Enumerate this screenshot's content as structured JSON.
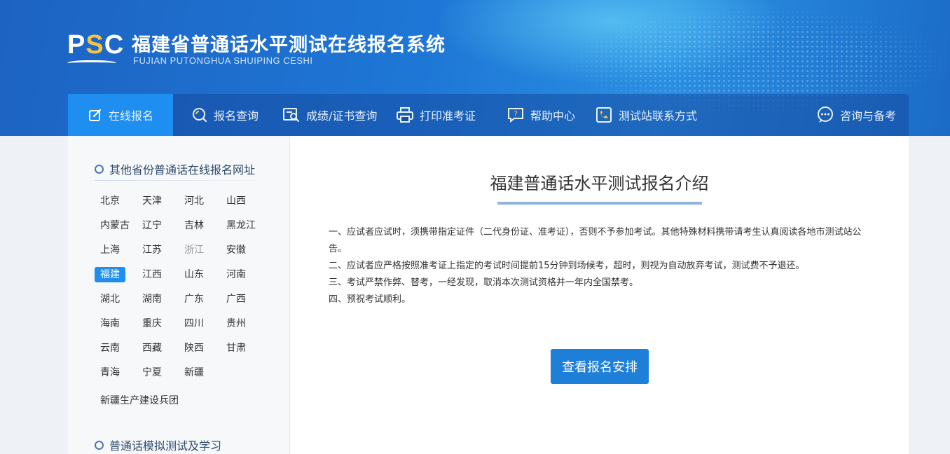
{
  "header": {
    "logo_text_p": "P",
    "logo_text_s": "S",
    "logo_text_c": "C",
    "title": "福建省普通话水平测试在线报名系统",
    "subtitle": "FUJIAN PUTONGHUA SHUIPING CESHI"
  },
  "nav": {
    "items": [
      {
        "label": "在线报名",
        "icon": "edit-icon"
      },
      {
        "label": "报名查询",
        "icon": "search-icon"
      },
      {
        "label": "成绩/证书查询",
        "icon": "certificate-search-icon"
      },
      {
        "label": "打印准考证",
        "icon": "printer-icon"
      },
      {
        "label": "帮助中心",
        "icon": "help-icon"
      },
      {
        "label": "测试站联系方式",
        "icon": "phone-icon"
      },
      {
        "label": "咨询与备考",
        "icon": "chat-icon"
      }
    ]
  },
  "sidebar": {
    "section1_title": "其他省份普通话在线报名网址",
    "provinces": [
      "北京",
      "天津",
      "河北",
      "山西",
      "内蒙古",
      "辽宁",
      "吉林",
      "黑龙江",
      "上海",
      "江苏",
      "浙江",
      "安徽",
      "福建",
      "江西",
      "山东",
      "河南",
      "湖北",
      "湖南",
      "广东",
      "广西",
      "海南",
      "重庆",
      "四川",
      "贵州",
      "云南",
      "西藏",
      "陕西",
      "甘肃",
      "青海",
      "宁夏",
      "新疆"
    ],
    "extra_province": "新疆生产建设兵团",
    "active_province": "福建",
    "disabled_province": "浙江",
    "section2_title": "普通话模拟测试及学习"
  },
  "main": {
    "title": "福建普通话水平测试报名介绍",
    "rules": [
      "一、应试者应试时，须携带指定证件（二代身份证、准考证），否则不予参加考试。其他特殊材料携带请考生认真阅读各地市测试站公告。",
      "二、应试者应严格按照准考证上指定的考试时间提前15分钟到场候考，超时，则视为自动放弃考试，测试费不予退还。",
      "三、考试严禁作弊、替考，一经发现，取消本次测试资格并一年内全国禁考。",
      "四、预祝考试顺利。"
    ],
    "button_label": "查看报名安排"
  },
  "colors": {
    "header_blue": "#1e77d6",
    "accent": "#1e8ef0",
    "button": "#1e7fd8",
    "logo_yellow": "#f6c343"
  }
}
